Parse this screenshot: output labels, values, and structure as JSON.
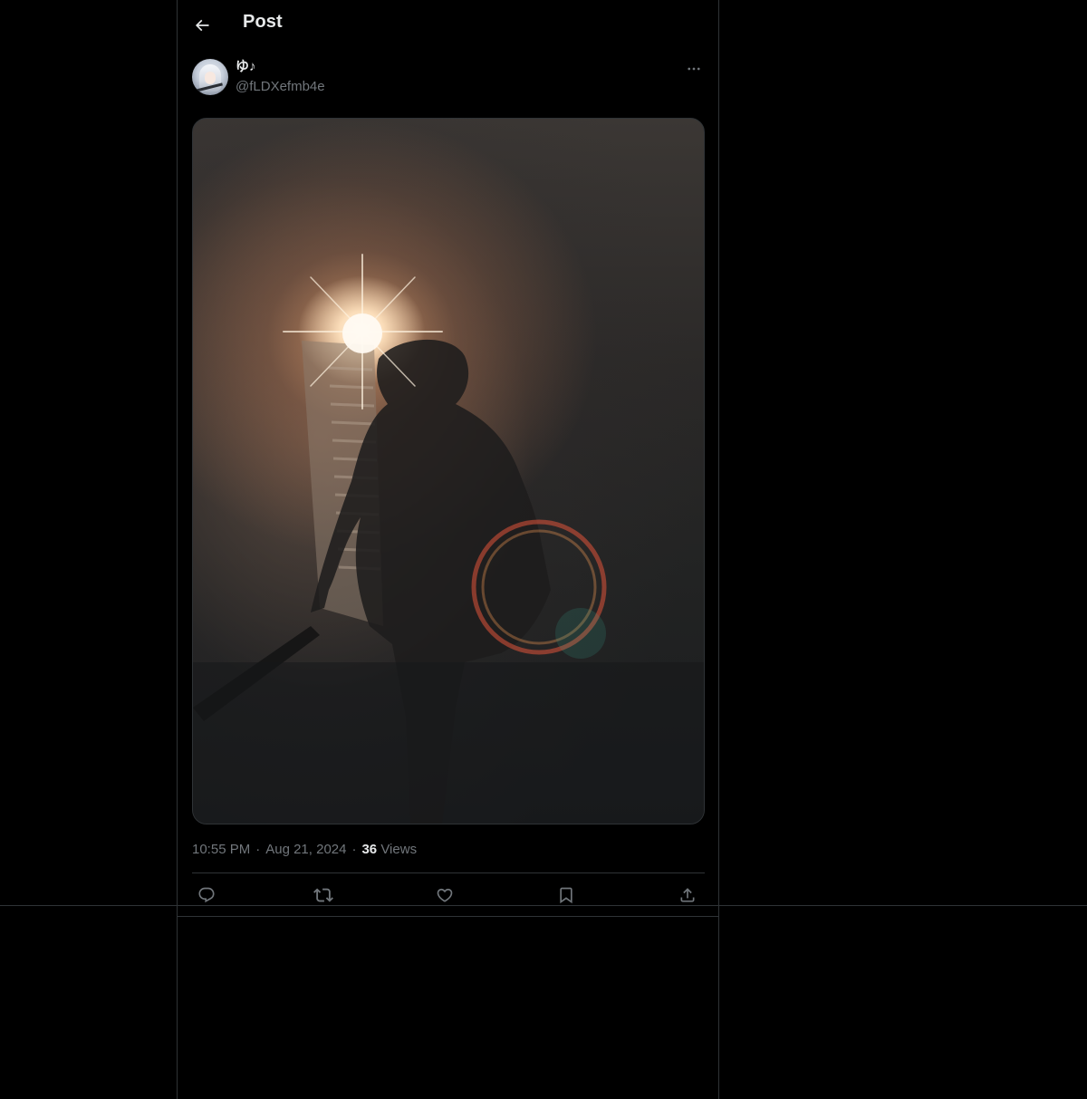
{
  "header": {
    "title": "Post",
    "back_icon": "arrow-left-icon"
  },
  "author": {
    "display_name": "ゆ♪",
    "handle": "@fLDXefmb4e",
    "avatar_icon": "avatar-image",
    "more_icon": "more-horizontal-icon"
  },
  "media": {
    "kind": "photo",
    "subject": "silhouetted figure holding a sword in a dark room with bright light flare"
  },
  "meta": {
    "time": "10:55 PM",
    "date": "Aug 21, 2024",
    "separator": "·",
    "views_count": "36",
    "views_label": "Views"
  },
  "actions": [
    {
      "name": "reply",
      "icon": "reply-icon"
    },
    {
      "name": "repost",
      "icon": "repost-icon"
    },
    {
      "name": "like",
      "icon": "heart-icon"
    },
    {
      "name": "bookmark",
      "icon": "bookmark-icon"
    },
    {
      "name": "share",
      "icon": "share-icon"
    }
  ],
  "colors": {
    "background": "#000000",
    "border": "#2f3336",
    "text_primary": "#e7e9ea",
    "text_secondary": "#71767b"
  }
}
